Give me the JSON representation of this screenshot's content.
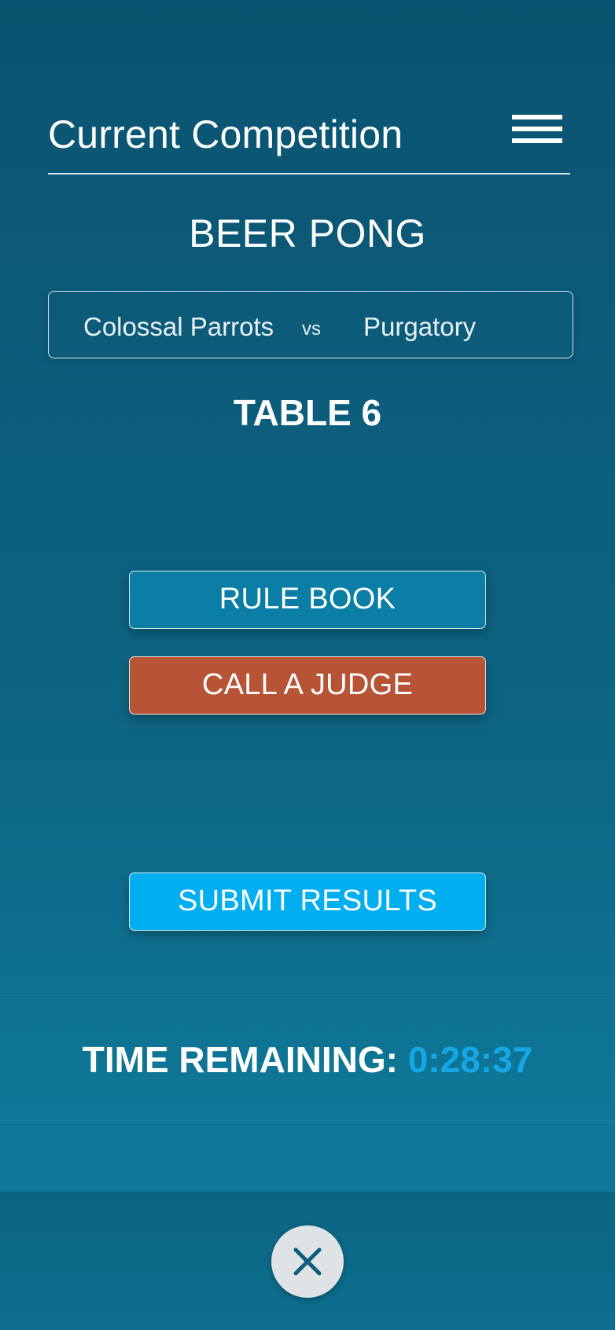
{
  "header": {
    "title": "Current Competition",
    "menu_icon": "hamburger-menu-icon"
  },
  "event": {
    "name": "BEER PONG"
  },
  "matchup": {
    "team_a": "Colossal Parrots",
    "vs": "vs",
    "team_b": "Purgatory"
  },
  "table": {
    "label": "TABLE 6"
  },
  "actions": {
    "rule_book": "RULE BOOK",
    "call_judge": "CALL A JUDGE",
    "submit_results": "SUBMIT RESULTS"
  },
  "timer": {
    "label": "TIME REMAINING:",
    "value": "0:28:37"
  },
  "footer": {
    "close_icon": "close-icon"
  },
  "colors": {
    "background": "#0b5a78",
    "rule_book_button": "#0a7ea5",
    "call_judge_button": "#b85436",
    "submit_button": "#01aff0",
    "timer_value": "#14a6e6",
    "close_button": "#dfe3e6",
    "close_icon": "#0b5f7d"
  }
}
